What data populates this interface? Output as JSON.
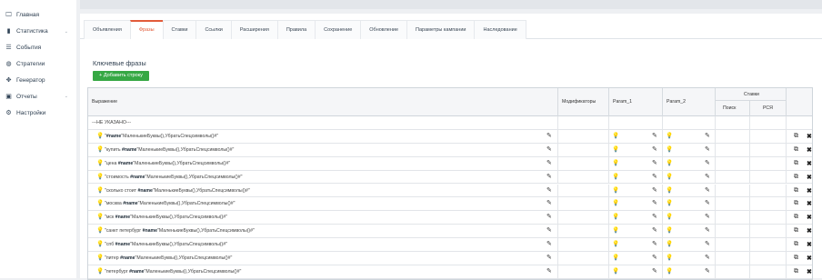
{
  "sidebar": {
    "items": [
      {
        "label": "Главная",
        "icon": "monitor-icon",
        "glyph": "🖵"
      },
      {
        "label": "Статистика",
        "icon": "bar-chart-icon",
        "glyph": "▮",
        "expandable": true
      },
      {
        "label": "События",
        "icon": "server-icon",
        "glyph": "☰"
      },
      {
        "label": "Стратегии",
        "icon": "globe-icon",
        "glyph": "◍"
      },
      {
        "label": "Генератор",
        "icon": "wand-icon",
        "glyph": "✥"
      },
      {
        "label": "Отчеты",
        "icon": "report-icon",
        "glyph": "▣",
        "expandable": true
      },
      {
        "label": "Настройки",
        "icon": "gear-icon",
        "glyph": "⚙"
      }
    ]
  },
  "tabs": [
    {
      "label": "Объявления",
      "active": false
    },
    {
      "label": "Фразы",
      "active": true
    },
    {
      "label": "Ставки",
      "active": false
    },
    {
      "label": "Ссылки",
      "active": false
    },
    {
      "label": "Расширения",
      "active": false
    },
    {
      "label": "Правила",
      "active": false
    },
    {
      "label": "Сохранение",
      "active": false
    },
    {
      "label": "Обновление",
      "active": false
    },
    {
      "label": "Параметры кампании",
      "active": false
    },
    {
      "label": "Наследование",
      "active": false
    }
  ],
  "section": {
    "title": "Ключевые фразы",
    "add_button": "+ Добавить строку"
  },
  "table": {
    "headers": {
      "expression": "Выражение",
      "modifiers": "Модификаторы",
      "param1": "Param_1",
      "param2": "Param_2",
      "bids": "Ставки",
      "search": "Поиск",
      "rsya": "РСЯ"
    },
    "rows": [
      {
        "pre": "---НЕ УКАЗАНО---",
        "kw": "",
        "post": "",
        "placeholder": true
      },
      {
        "pre": "\"",
        "kw": "#name",
        "post": "\"МаленькиеБуквы(),УбратьСпецсимволы()#\""
      },
      {
        "pre": "\"купить ",
        "kw": "#name",
        "post": "\"МаленькиеБуквы(),УбратьСпецсимволы()#\""
      },
      {
        "pre": "\"цена ",
        "kw": "#name",
        "post": "\"МаленькиеБуквы(),УбратьСпецсимволы()#\""
      },
      {
        "pre": "\"стоимость ",
        "kw": "#name",
        "post": "\"МаленькиеБуквы(),УбратьСпецсимволы()#\""
      },
      {
        "pre": "\"сколько стоит ",
        "kw": "#name",
        "post": "\"МаленькиеБуквы(),УбратьСпецсимволы()#\""
      },
      {
        "pre": "\"москва ",
        "kw": "#name",
        "post": "\"МаленькиеБуквы(),УбратьСпецсимволы()#\""
      },
      {
        "pre": "\"мск ",
        "kw": "#name",
        "post": "\"МаленькиеБуквы(),УбратьСпецсимволы()#\""
      },
      {
        "pre": "\"санкт петербург ",
        "kw": "#name",
        "post": "\"МаленькиеБуквы(),УбратьСпецсимволы()#\""
      },
      {
        "pre": "\"спб ",
        "kw": "#name",
        "post": "\"МаленькиеБуквы(),УбратьСпецсимволы()#\""
      },
      {
        "pre": "\"питер ",
        "kw": "#name",
        "post": "\"МаленькиеБуквы(),УбратьСпецсимволы()#\""
      },
      {
        "pre": "\"петербург ",
        "kw": "#name",
        "post": "\"МаленькиеБуквы(),УбратьСпецсимволы()#\""
      }
    ]
  },
  "colors": {
    "accent": "#e25b3a",
    "add_button": "#36a844",
    "bulb": "#57b34a"
  }
}
